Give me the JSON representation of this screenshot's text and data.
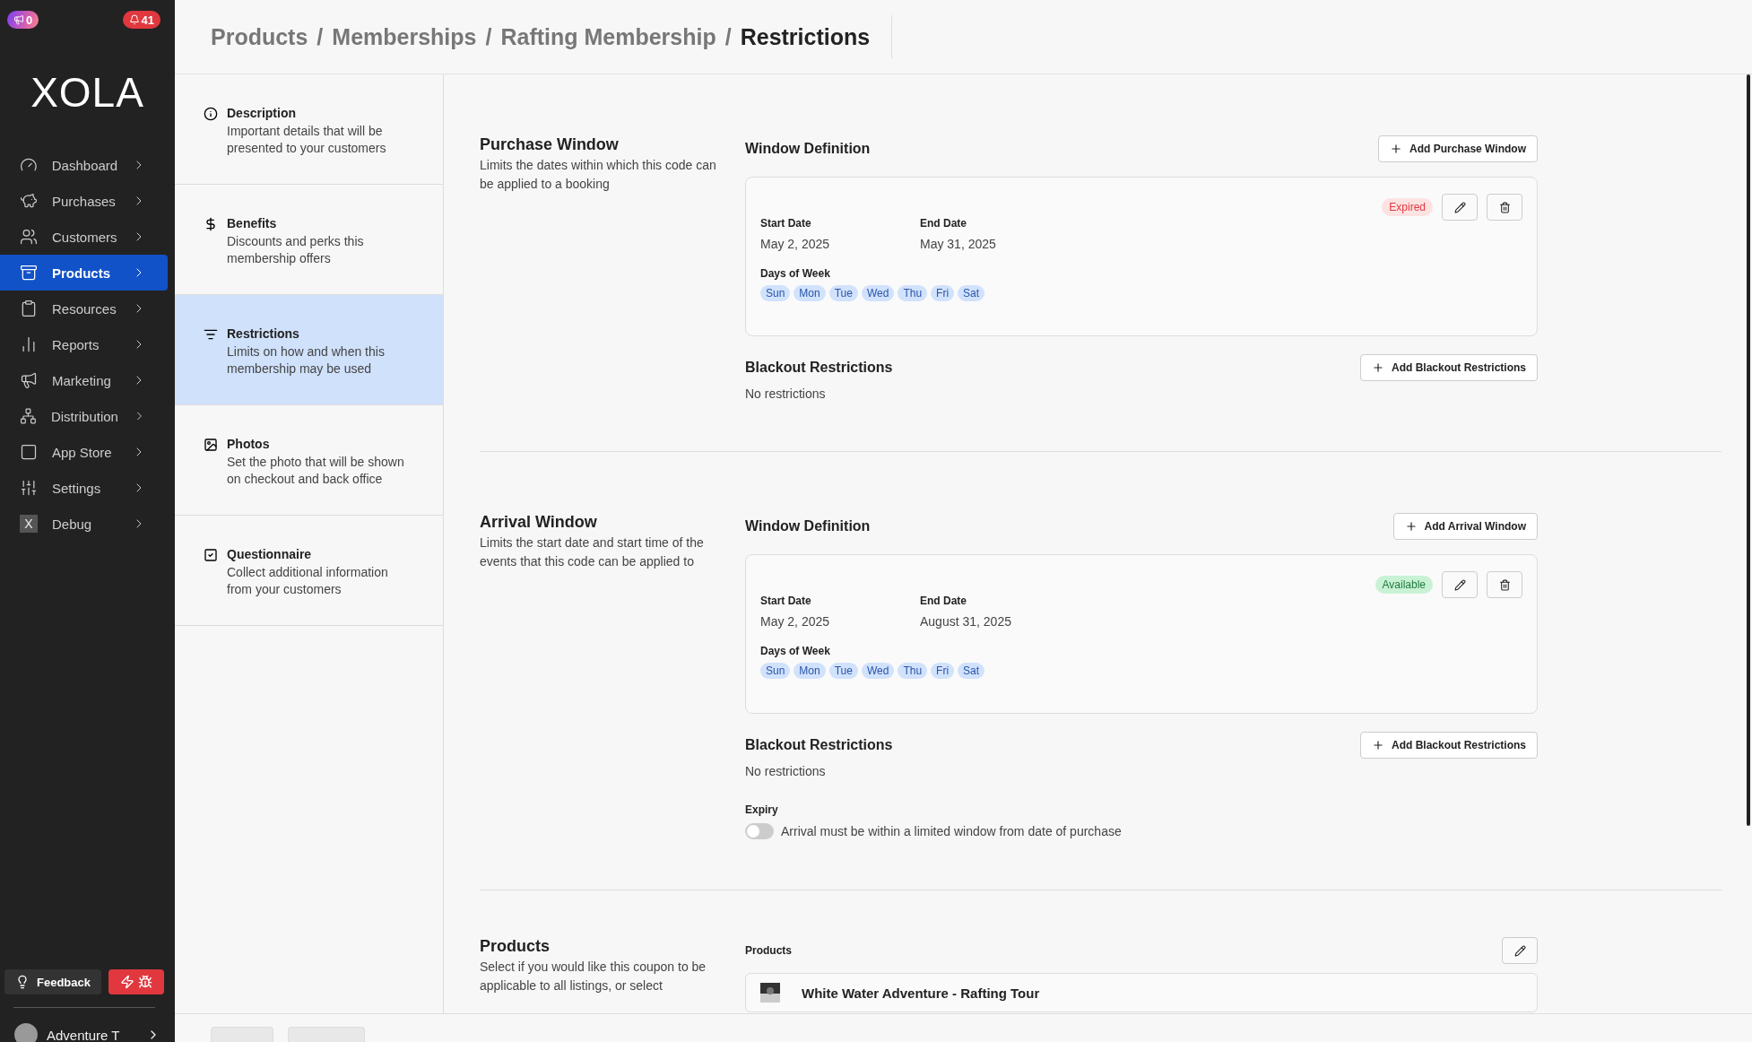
{
  "badges": [
    {
      "kind": "announce",
      "text": "0"
    },
    {
      "kind": "alert",
      "text": "41"
    }
  ],
  "logo": "XOLA",
  "nav": [
    {
      "label": "Dashboard",
      "selected": false
    },
    {
      "label": "Purchases",
      "selected": false
    },
    {
      "label": "Customers",
      "selected": false
    },
    {
      "label": "Products",
      "selected": true
    },
    {
      "label": "Resources",
      "selected": false
    },
    {
      "label": "Reports",
      "selected": false
    },
    {
      "label": "Marketing",
      "selected": false
    },
    {
      "label": "Distribution",
      "selected": false
    },
    {
      "label": "App Store",
      "selected": false
    },
    {
      "label": "Settings",
      "selected": false
    },
    {
      "label": "Debug",
      "selected": false
    }
  ],
  "debug_icon_letter": "X",
  "feedback": "Feedback",
  "user": "Adventure T",
  "breadcrumb": {
    "separator": "/",
    "items": [
      "Products",
      "Memberships",
      "Rafting Membership",
      "Restrictions"
    ]
  },
  "sections": [
    {
      "title": "Description",
      "description": "Important details that will be presented to your customers",
      "selected": false
    },
    {
      "title": "Benefits",
      "description": "Discounts and perks this membership offers",
      "selected": false
    },
    {
      "title": "Restrictions",
      "description": "Limits on how and when this membership may be used",
      "selected": true
    },
    {
      "title": "Photos",
      "description": "Set the photo that will be shown on checkout and back office",
      "selected": false
    },
    {
      "title": "Questionnaire",
      "description": "Collect additional information from your customers",
      "selected": false
    }
  ],
  "blocks": [
    {
      "title": "Purchase Window",
      "description": "Limits the dates within which this code can be applied to a booking",
      "window_heading": "Window Definition",
      "add_button": "Add Purchase Window",
      "windows": [
        {
          "status": "Expired",
          "expired": true,
          "start_label": "Start Date",
          "start": "May 2, 2025",
          "end_label": "End Date",
          "end": "May 31, 2025",
          "days_label": "Days of Week",
          "days": [
            "Sun",
            "Mon",
            "Tue",
            "Wed",
            "Thu",
            "Fri",
            "Sat"
          ]
        }
      ],
      "blackout_title": "Blackout Restrictions",
      "blackout_button": "Add Blackout Restrictions",
      "blackout_empty": "No restrictions"
    },
    {
      "title": "Arrival Window",
      "description": "Limits the start date and start time of the events that this code can be applied to",
      "window_heading": "Window Definition",
      "add_button": "Add Arrival Window",
      "windows": [
        {
          "status": "Available",
          "expired": false,
          "start_label": "Start Date",
          "start": "May 2, 2025",
          "end_label": "End Date",
          "end": "August 31, 2025",
          "days_label": "Days of Week",
          "days": [
            "Sun",
            "Mon",
            "Tue",
            "Wed",
            "Thu",
            "Fri",
            "Sat"
          ]
        }
      ],
      "blackout_title": "Blackout Restrictions",
      "blackout_button": "Add Blackout Restrictions",
      "blackout_empty": "No restrictions",
      "expiry": {
        "label": "Expiry",
        "text": "Arrival must be within a limited window from date of purchase",
        "on": false
      }
    }
  ],
  "products": {
    "title": "Products",
    "description": "Select if you would like this coupon to be applicable to all listings, or select",
    "label": "Products",
    "items": [
      {
        "name": "White Water Adventure - Rafting Tour"
      }
    ]
  }
}
